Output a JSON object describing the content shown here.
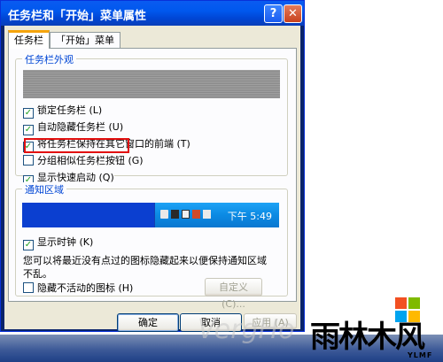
{
  "window": {
    "title": "任务栏和「开始」菜单属性",
    "help_glyph": "?",
    "close_glyph": "✕"
  },
  "tabs": [
    {
      "label": "任务栏",
      "active": true
    },
    {
      "label": "「开始」菜单",
      "active": false
    }
  ],
  "appearance": {
    "legend": "任务栏外观",
    "options": [
      {
        "label": "锁定任务栏 (L)",
        "checked": true
      },
      {
        "label": "自动隐藏任务栏 (U)",
        "checked": true,
        "highlighted": true
      },
      {
        "label": "将任务栏保持在其它窗口的前端 (T)",
        "checked": true
      },
      {
        "label": "分组相似任务栏按钮 (G)",
        "checked": false
      },
      {
        "label": "显示快速启动 (Q)",
        "checked": true
      }
    ]
  },
  "notification": {
    "legend": "通知区域",
    "clock_text": "下午 5:49",
    "tray_icons": [
      "volume-icon",
      "network-icon",
      "monitor-icon",
      "security-icon",
      "speaker-icon"
    ],
    "show_clock": {
      "label": "显示时钟 (K)",
      "checked": true
    },
    "description": "您可以将最近没有点过的图标隐藏起来以便保持通知区域不乱。",
    "hide_inactive": {
      "label": "隐藏不活动的图标 (H)",
      "checked": false
    },
    "customize_label": "自定义 (C)..."
  },
  "buttons": {
    "ok": "确定",
    "cancel": "取消",
    "apply": "应用 (A)"
  },
  "overlay": {
    "watermark": "VergHo",
    "logo_text": "雨林木风",
    "logo_sub": "YLMF"
  },
  "colors": {
    "title_bar": "#0058ee",
    "highlight_box": "#e21010",
    "legend_text": "#0046d5",
    "checkmark": "#21a121"
  }
}
